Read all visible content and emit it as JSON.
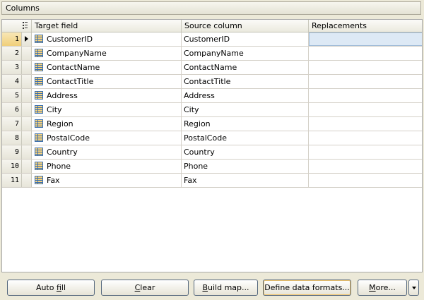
{
  "panel": {
    "title": "Columns"
  },
  "grid": {
    "columns": [
      "Target field",
      "Source column",
      "Replacements"
    ],
    "rows": [
      {
        "num": "1",
        "target": "CustomerID",
        "source": "CustomerID",
        "replacements": ""
      },
      {
        "num": "2",
        "target": "CompanyName",
        "source": "CompanyName",
        "replacements": ""
      },
      {
        "num": "3",
        "target": "ContactName",
        "source": "ContactName",
        "replacements": ""
      },
      {
        "num": "4",
        "target": "ContactTitle",
        "source": "ContactTitle",
        "replacements": ""
      },
      {
        "num": "5",
        "target": "Address",
        "source": "Address",
        "replacements": ""
      },
      {
        "num": "6",
        "target": "City",
        "source": "City",
        "replacements": ""
      },
      {
        "num": "7",
        "target": "Region",
        "source": "Region",
        "replacements": ""
      },
      {
        "num": "8",
        "target": "PostalCode",
        "source": "PostalCode",
        "replacements": ""
      },
      {
        "num": "9",
        "target": "Country",
        "source": "Country",
        "replacements": ""
      },
      {
        "num": "10",
        "target": "Phone",
        "source": "Phone",
        "replacements": ""
      },
      {
        "num": "11",
        "target": "Fax",
        "source": "Fax",
        "replacements": ""
      }
    ]
  },
  "buttons": {
    "auto_fill": {
      "pre": "Auto ",
      "u": "f",
      "post": "ill"
    },
    "clear": {
      "pre": "",
      "u": "C",
      "post": "lear"
    },
    "build_map": {
      "pre": "",
      "u": "B",
      "post": "uild map..."
    },
    "define_formats": {
      "pre": "Define data formats...",
      "u": "",
      "post": ""
    },
    "more": {
      "pre": "",
      "u": "M",
      "post": "ore..."
    }
  },
  "icons": {
    "row_icon": "table-icon",
    "sort": "column-chooser-icon",
    "indicator": "current-row-arrow-icon",
    "dropdown": "chevron-down-icon"
  },
  "colors": {
    "selection": "#dde9f5",
    "current_row": "#f0cf7a",
    "icon_blue": "#3a6fb0"
  }
}
